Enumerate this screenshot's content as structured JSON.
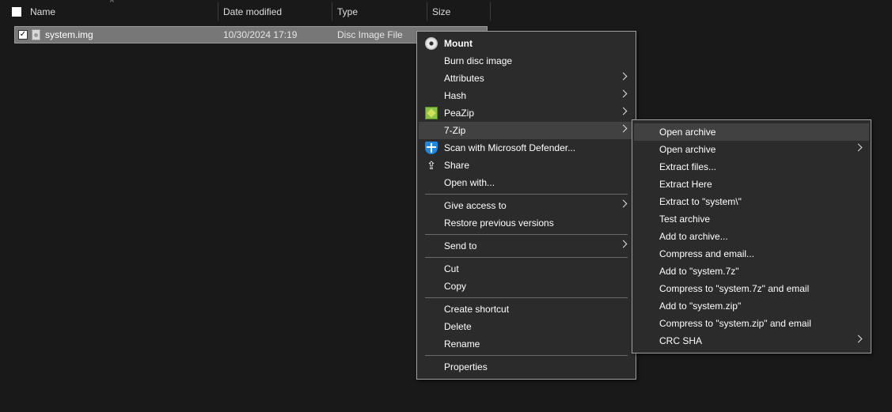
{
  "columns": {
    "name": "Name",
    "date_modified": "Date modified",
    "type": "Type",
    "size": "Size"
  },
  "file": {
    "name": "system.img",
    "date_modified": "10/30/2024 17:19",
    "type": "Disc Image File"
  },
  "context_menu": {
    "mount": "Mount",
    "burn": "Burn disc image",
    "attributes": "Attributes",
    "hash": "Hash",
    "peazip": "PeaZip",
    "sevenzip": "7-Zip",
    "scan": "Scan with Microsoft Defender...",
    "share": "Share",
    "open_with": "Open with...",
    "give_access": "Give access to",
    "restore": "Restore previous versions",
    "send_to": "Send to",
    "cut": "Cut",
    "copy": "Copy",
    "create_shortcut": "Create shortcut",
    "delete": "Delete",
    "rename": "Rename",
    "properties": "Properties"
  },
  "submenu_7zip": {
    "items": [
      "Open archive",
      "Open archive",
      "Extract files...",
      "Extract Here",
      "Extract to \"system\\\"",
      "Test archive",
      "Add to archive...",
      "Compress and email...",
      "Add to \"system.7z\"",
      "Compress to \"system.7z\" and email",
      "Add to \"system.zip\"",
      "Compress to \"system.zip\" and email",
      "CRC SHA"
    ]
  },
  "colors": {
    "background": "#191919",
    "menu_bg": "#2b2b2b",
    "menu_hover": "#414141",
    "selected_row": "#777777"
  }
}
